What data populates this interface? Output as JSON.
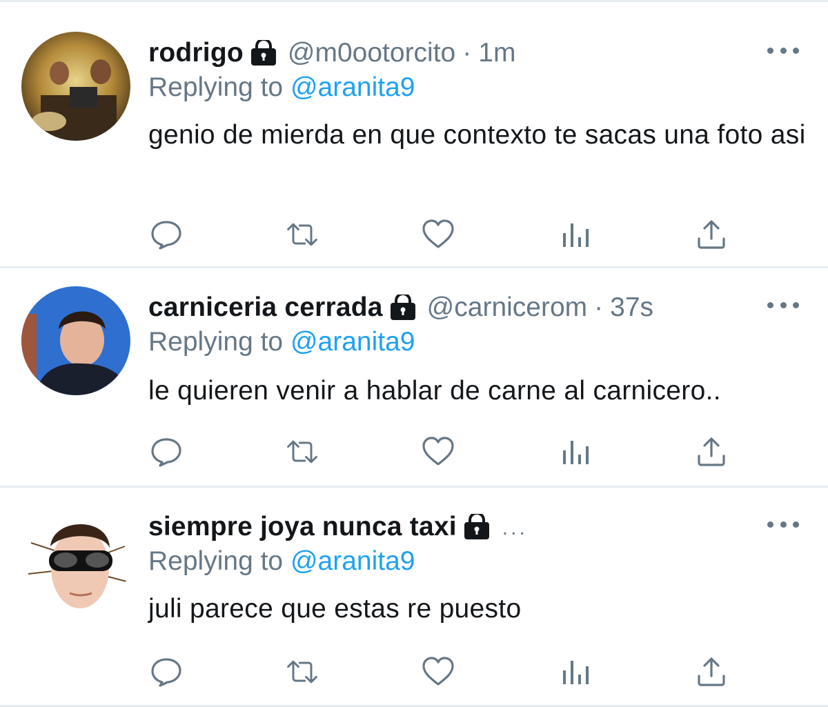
{
  "replies": [
    {
      "name": "rodrigo",
      "protected_icon": "lock-icon",
      "handle": "@m0ootorcito",
      "separator": "·",
      "time": "1m",
      "replying_prefix": "Replying to",
      "replying_mention": "@aranita9",
      "text": "genio de mierda en que contexto te sacas una foto asi",
      "avatar": "avatar-image"
    },
    {
      "name": "carniceria cerrada",
      "protected_icon": "lock-icon",
      "handle": "@carnicerom",
      "separator": "·",
      "time": "37s",
      "replying_prefix": "Replying to",
      "replying_mention": "@aranita9",
      "text": "le quieren venir a hablar de carne al carnicero..",
      "avatar": "avatar-image"
    },
    {
      "name": "siempre joya nunca taxi",
      "protected_icon": "lock-icon",
      "truncation": "...",
      "replying_prefix": "Replying to",
      "replying_mention": "@aranita9",
      "text": "juli parece que estas re puesto",
      "avatar": "avatar-image"
    }
  ],
  "actions": [
    "reply-icon",
    "retweet-icon",
    "like-icon",
    "analytics-icon",
    "share-icon"
  ],
  "colors": {
    "primary_text": "#14171a",
    "secondary_text": "#657786",
    "mention": "#1da1f2",
    "divider": "#e6ecf0",
    "icon": "#657786"
  }
}
